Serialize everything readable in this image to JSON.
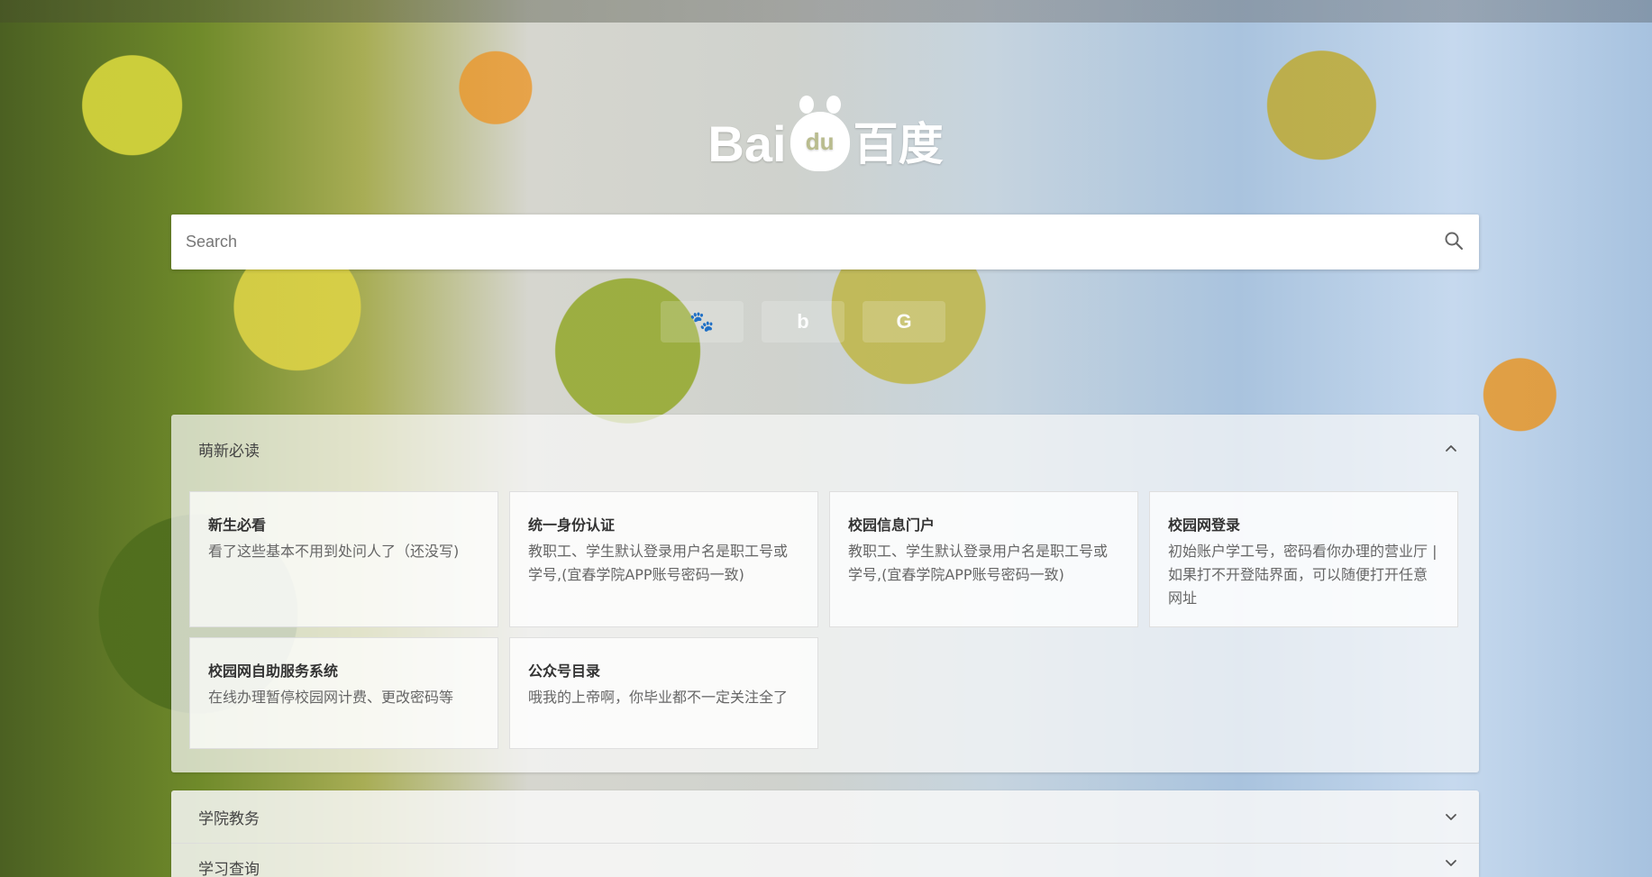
{
  "logo": {
    "left_text": "Bai",
    "paw_text": "du",
    "right_text": "百度"
  },
  "search": {
    "placeholder": "Search"
  },
  "engines": [
    {
      "name": "baidu",
      "icon": "paw-icon",
      "glyph": "🐾"
    },
    {
      "name": "bing",
      "icon": "bing-icon",
      "glyph": "b"
    },
    {
      "name": "google",
      "icon": "google-icon",
      "glyph": "G"
    }
  ],
  "sections": {
    "must_read": {
      "title": "萌新必读",
      "cards": [
        {
          "title": "新生必看",
          "desc": "看了这些基本不用到处问人了（还没写)"
        },
        {
          "title": "统一身份认证",
          "desc": "教职工、学生默认登录用户名是职工号或学号,(宜春学院APP账号密码一致)"
        },
        {
          "title": "校园信息门户",
          "desc": "教职工、学生默认登录用户名是职工号或学号,(宜春学院APP账号密码一致)"
        },
        {
          "title": "校园网登录",
          "desc": "初始账户学工号，密码看你办理的营业厅 | 如果打不开登陆界面，可以随便打开任意网址"
        },
        {
          "title": "校园网自助服务系统",
          "desc": "在线办理暂停校园网计费、更改密码等"
        },
        {
          "title": "公众号目录",
          "desc": "哦我的上帝啊，你毕业都不一定关注全了"
        }
      ]
    },
    "academic": {
      "title": "学院教务"
    },
    "study_query": {
      "title": "学习查询"
    }
  }
}
